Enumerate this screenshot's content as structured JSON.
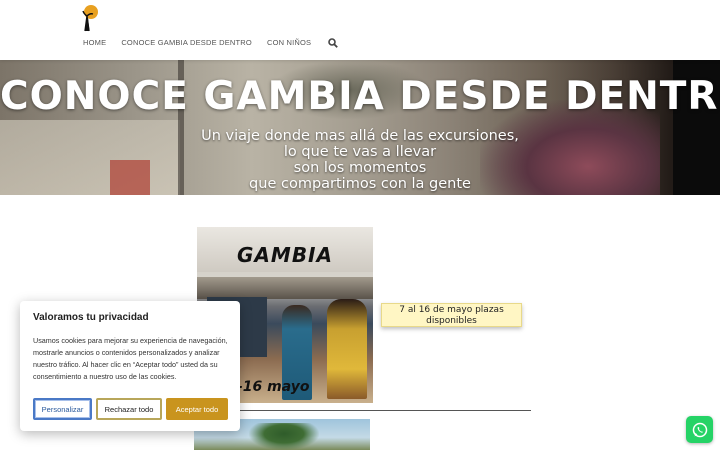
{
  "header": {
    "logo_icon": "baobab-logo-icon",
    "nav": [
      {
        "label": "HOME"
      },
      {
        "label": "CONOCE GAMBIA DESDE DENTRO"
      },
      {
        "label": "CON NIÑOS"
      }
    ],
    "search_icon": "search-icon"
  },
  "hero": {
    "title": "CONOCE GAMBIA DESDE DENTRO",
    "subtitle_lines": [
      "Un viaje donde mas allá de las excursiones,",
      "lo que te vas a llevar",
      "son los momentos",
      "que compartimos con la gente"
    ]
  },
  "poster": {
    "title": "GAMBIA",
    "dates": "-16 mayo"
  },
  "badge": {
    "text_lines": [
      "7 al 16 de mayo plazas",
      "disponibles"
    ]
  },
  "cookie": {
    "title": "Valoramos tu privacidad",
    "body": "Usamos cookies para mejorar su experiencia de navegación, mostrarle anuncios o contenidos personalizados y analizar nuestro tráfico. Al hacer clic en “Aceptar todo” usted da su consentimiento a nuestro uso de las cookies.",
    "buttons": {
      "customize": "Personalizar",
      "reject": "Rechazar todo",
      "accept": "Aceptar todo"
    }
  },
  "whatsapp_icon": "whatsapp-icon",
  "colors": {
    "accent": "#c9941e",
    "customize_border": "#4a79c6",
    "badge_bg": "#fff6c4",
    "whatsapp": "#25d366"
  }
}
